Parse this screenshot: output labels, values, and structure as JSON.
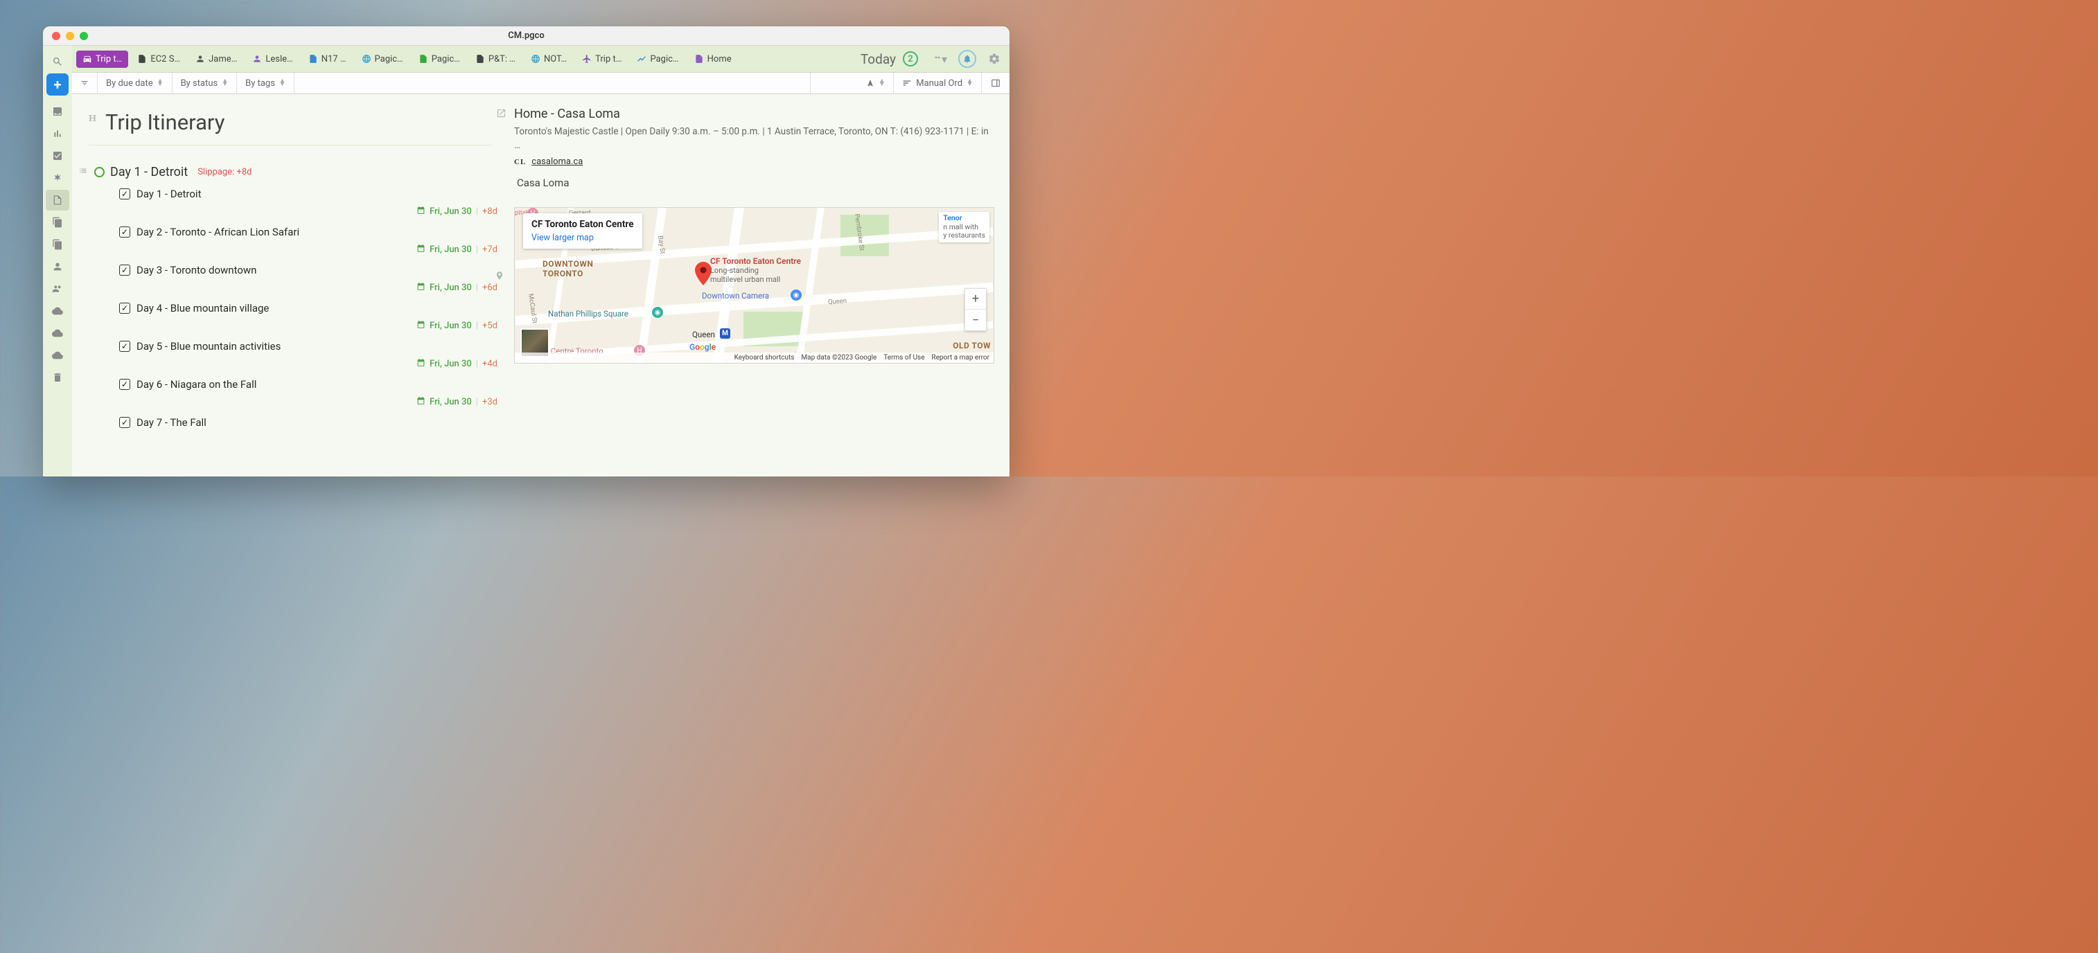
{
  "window_title": "CM.pgco",
  "tabs": [
    {
      "label": "Trip t…",
      "active": true,
      "icon": "car"
    },
    {
      "label": "EC2 S…",
      "icon": "file"
    },
    {
      "label": "Jame…",
      "icon": "person"
    },
    {
      "label": "Lesle…",
      "icon": "person-p"
    },
    {
      "label": "N17 …",
      "icon": "file-b"
    },
    {
      "label": "Pagic…",
      "icon": "globe"
    },
    {
      "label": "Pagic…",
      "icon": "file-g"
    },
    {
      "label": "P&T: …",
      "icon": "file"
    },
    {
      "label": "NOT…",
      "icon": "globe"
    },
    {
      "label": "Trip t…",
      "icon": "plane"
    },
    {
      "label": "Pagic…",
      "icon": "chart"
    },
    {
      "label": "Home",
      "icon": "file-p"
    }
  ],
  "today_label": "Today",
  "today_badge": "2",
  "filters": {
    "due": "By due date",
    "status": "By status",
    "tags": "By tags",
    "sort": "Manual Ord"
  },
  "page_title": "Trip Itinerary",
  "section": {
    "title": "Day 1 - Detroit",
    "slippage": "Slippage: +8d"
  },
  "items": [
    {
      "title": "Day 1 - Detroit",
      "due": "Fri, Jun 30",
      "delta": "+8d"
    },
    {
      "title": "Day 2 - Toronto - African Lion Safari",
      "due": "Fri, Jun 30",
      "delta": "+7d"
    },
    {
      "title": "Day 3 - Toronto downtown",
      "due": "Fri, Jun 30",
      "delta": "+6d"
    },
    {
      "title": "Day 4 - Blue mountain village",
      "due": "Fri, Jun 30",
      "delta": "+5d"
    },
    {
      "title": "Day 5 - Blue mountain activities",
      "due": "Fri, Jun 30",
      "delta": "+4d"
    },
    {
      "title": "Day 6 - Niagara on the Fall",
      "due": "Fri, Jun 30",
      "delta": "+3d"
    },
    {
      "title": "Day 7 - The Fall",
      "due": "",
      "delta": ""
    }
  ],
  "detail": {
    "title": "Home - Casa Loma",
    "desc": "Toronto's Majestic Castle | Open Daily 9:30 a.m. – 5:00 p.m. | 1 Austin Terrace, Toronto, ON T: (416) 923-1171 | E: in …",
    "source_badge": "CL",
    "source_link": "casaloma.ca",
    "location_name": "Casa Loma"
  },
  "map": {
    "info_title": "CF Toronto Eaton Centre",
    "info_link": "View larger map",
    "callout_name": "CF Toronto Eaton Centre",
    "callout_sub1": "Long-standing",
    "callout_sub2": "multilevel urban mall",
    "downtown_label": "DOWNTOWN\nTORONTO",
    "old_town_label": "OLD TOW",
    "poi_np": "Nathan Phillips Square",
    "poi_dc": "Downtown Camera",
    "poi_ec": "on Centre Toronto",
    "tenor_title": "Tenor",
    "tenor_sub": "n mall with\ny restaurants",
    "queen_label": "Queen",
    "streets": {
      "gerrard": "Gerrard",
      "dundas": "Dundas St W",
      "bay": "Bay St",
      "queen": "Queen",
      "pembroke": "Pembroke St",
      "mccaul": "McCaul St"
    },
    "hospital_label": "pital",
    "footer": {
      "shortcuts": "Keyboard shortcuts",
      "data": "Map data ©2023 Google",
      "terms": "Terms of Use",
      "report": "Report a map error"
    }
  }
}
